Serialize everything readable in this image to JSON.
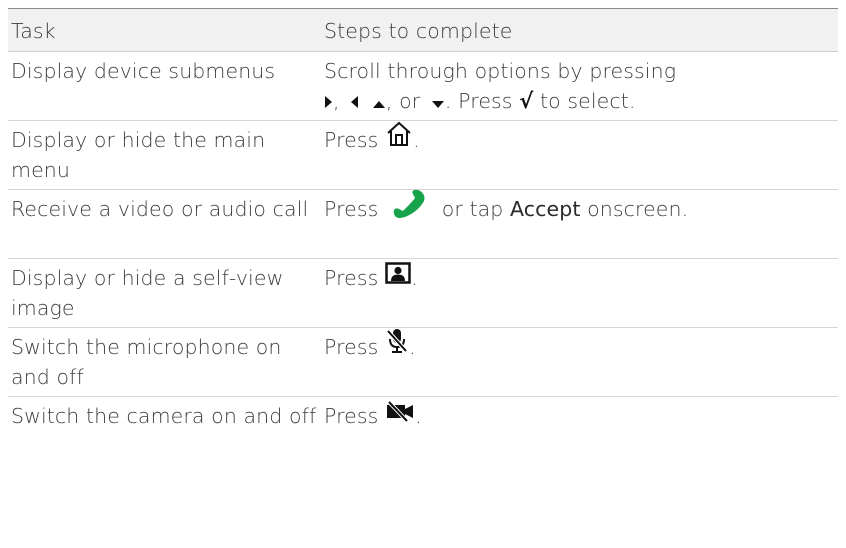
{
  "table": {
    "header": {
      "task": "Task",
      "steps": "Steps to complete"
    },
    "rows": [
      {
        "task": "Display device submenus",
        "steps": {
          "line1": "Scroll through options by pressing",
          "sep1": ",",
          "sep2": ", or",
          "sep3": ". Press",
          "check_glyph": "√",
          "end": "to select."
        }
      },
      {
        "task": "Display or hide the main menu",
        "steps": {
          "before": "Press",
          "after": "."
        }
      },
      {
        "task": "Receive a video or audio call",
        "steps": {
          "before": "Press",
          "middle": "or tap",
          "accept": "Accept",
          "after": "onscreen."
        }
      },
      {
        "task": "Display or hide a self-view image",
        "steps": {
          "before": "Press",
          "after": "."
        }
      },
      {
        "task": "Switch the microphone on and off",
        "steps": {
          "before": "Press",
          "after": "."
        }
      },
      {
        "task": "Switch the camera on and off",
        "steps": {
          "before": "Press",
          "after": "."
        }
      }
    ]
  },
  "icons": {
    "arrow_right": "arrow-right-icon",
    "arrow_left": "arrow-left-icon",
    "arrow_up": "arrow-up-icon",
    "arrow_down": "arrow-down-icon",
    "home": "home-icon",
    "call": "green-phone-icon",
    "selfview": "selfview-icon",
    "mic": "mic-mute-icon",
    "camera": "camera-mute-icon"
  },
  "colors": {
    "call_green": "#17a34a",
    "header_bg": "#f1f1f1"
  }
}
